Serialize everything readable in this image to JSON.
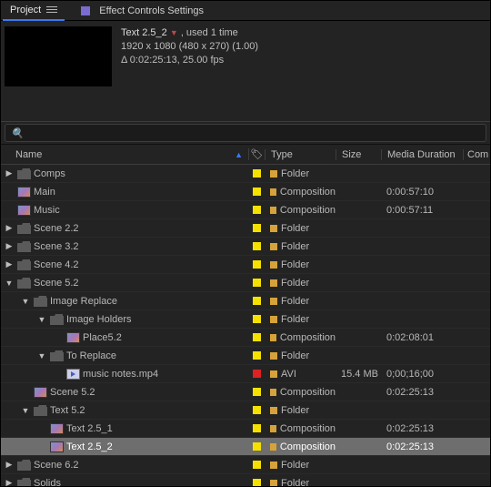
{
  "tabs": {
    "project": "Project",
    "effects": "Effect Controls Settings"
  },
  "selected": {
    "title": "Text 2.5_2",
    "usage": ", used 1 time",
    "dims": "1920 x 1080  (480 x 270) (1.00)",
    "delta": "Δ 0:02:25:13, 25.00 fps"
  },
  "search": {
    "placeholder": ""
  },
  "columns": {
    "name": "Name",
    "type": "Type",
    "size": "Size",
    "duration": "Media Duration",
    "comment": "Com"
  },
  "rows": [
    {
      "depth": 0,
      "twisty": "▶",
      "icon": "folder",
      "label": "Comps",
      "tag": "yellow",
      "type": "Folder",
      "size": "",
      "dur": ""
    },
    {
      "depth": 0,
      "twisty": "",
      "icon": "comp",
      "label": "Main",
      "tag": "yellow",
      "type": "Composition",
      "size": "",
      "dur": "0:00:57:10"
    },
    {
      "depth": 0,
      "twisty": "",
      "icon": "comp",
      "label": "Music",
      "tag": "yellow",
      "type": "Composition",
      "size": "",
      "dur": "0:00:57:11"
    },
    {
      "depth": 0,
      "twisty": "▶",
      "icon": "folder",
      "label": "Scene 2.2",
      "tag": "yellow",
      "type": "Folder",
      "size": "",
      "dur": ""
    },
    {
      "depth": 0,
      "twisty": "▶",
      "icon": "folder",
      "label": "Scene 3.2",
      "tag": "yellow",
      "type": "Folder",
      "size": "",
      "dur": ""
    },
    {
      "depth": 0,
      "twisty": "▶",
      "icon": "folder",
      "label": "Scene 4.2",
      "tag": "yellow",
      "type": "Folder",
      "size": "",
      "dur": ""
    },
    {
      "depth": 0,
      "twisty": "▼",
      "icon": "folder",
      "label": "Scene 5.2",
      "tag": "yellow",
      "type": "Folder",
      "size": "",
      "dur": ""
    },
    {
      "depth": 1,
      "twisty": "▼",
      "icon": "folder",
      "label": "Image Replace",
      "tag": "yellow",
      "type": "Folder",
      "size": "",
      "dur": ""
    },
    {
      "depth": 2,
      "twisty": "▼",
      "icon": "folder",
      "label": "Image Holders",
      "tag": "yellow",
      "type": "Folder",
      "size": "",
      "dur": ""
    },
    {
      "depth": 3,
      "twisty": "",
      "icon": "comp",
      "label": "Place5.2",
      "tag": "yellow",
      "type": "Composition",
      "size": "",
      "dur": "0:02:08:01"
    },
    {
      "depth": 2,
      "twisty": "▼",
      "icon": "folder",
      "label": "To Replace",
      "tag": "yellow",
      "type": "Folder",
      "size": "",
      "dur": ""
    },
    {
      "depth": 3,
      "twisty": "",
      "icon": "video",
      "label": "music notes.mp4",
      "tag": "red",
      "type": "AVI",
      "size": "15.4 MB",
      "dur": "0;00;16;00"
    },
    {
      "depth": 1,
      "twisty": "",
      "icon": "comp",
      "label": "Scene 5.2",
      "tag": "yellow",
      "type": "Composition",
      "size": "",
      "dur": "0:02:25:13"
    },
    {
      "depth": 1,
      "twisty": "▼",
      "icon": "folder",
      "label": "Text 5.2",
      "tag": "yellow",
      "type": "Folder",
      "size": "",
      "dur": ""
    },
    {
      "depth": 2,
      "twisty": "",
      "icon": "comp",
      "label": "Text 2.5_1",
      "tag": "yellow",
      "type": "Composition",
      "size": "",
      "dur": "0:02:25:13"
    },
    {
      "depth": 2,
      "twisty": "",
      "icon": "comp",
      "label": "Text 2.5_2",
      "tag": "yellow",
      "type": "Composition",
      "size": "",
      "dur": "0:02:25:13",
      "selected": true
    },
    {
      "depth": 0,
      "twisty": "▶",
      "icon": "folder",
      "label": "Scene 6.2",
      "tag": "yellow",
      "type": "Folder",
      "size": "",
      "dur": ""
    },
    {
      "depth": 0,
      "twisty": "▶",
      "icon": "folder",
      "label": "Solids",
      "tag": "yellow",
      "type": "Folder",
      "size": "",
      "dur": ""
    }
  ]
}
